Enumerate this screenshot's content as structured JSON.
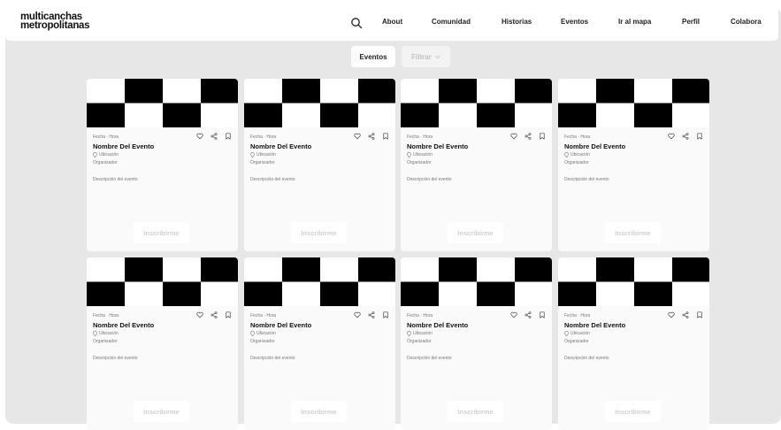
{
  "brand": {
    "line1": "multicanchas",
    "line2": "metropolitanas"
  },
  "nav": {
    "search_icon": "search-icon",
    "links": [
      "About",
      "Comunidad",
      "Historias",
      "Eventos",
      "Ir al mapa",
      "Perfil",
      "Colabora"
    ]
  },
  "toolbar": {
    "events_label": "Eventos",
    "filter_label": "Filtrar",
    "filter_icon": "chevron-down-icon"
  },
  "colors": {
    "background": "#e7e7e7",
    "card": "#fafafa",
    "placeholder_dark": "#000000",
    "muted_text": "#777777",
    "button_text": "#cfcfcf"
  },
  "cards": [
    {
      "meta": "Fecha · Hora",
      "title": "Nombre Del Evento",
      "location": "Ubicación",
      "organizer": "Organizador",
      "description": "Descripción del evento",
      "button": "Inscribirme"
    },
    {
      "meta": "Fecha · Hora",
      "title": "Nombre Del Evento",
      "location": "Ubicación",
      "organizer": "Organizador",
      "description": "Descripción del evento",
      "button": "Inscribirme"
    },
    {
      "meta": "Fecha · Hora",
      "title": "Nombre Del Evento",
      "location": "Ubicación",
      "organizer": "Organizador",
      "description": "Descripción del evento",
      "button": "Inscribirme"
    },
    {
      "meta": "Fecha · Hora",
      "title": "Nombre Del Evento",
      "location": "Ubicación",
      "organizer": "Organizador",
      "description": "Descripción del evento",
      "button": "Inscribirme"
    },
    {
      "meta": "Fecha · Hora",
      "title": "Nombre Del Evento",
      "location": "Ubicación",
      "organizer": "Organizador",
      "description": "Descripción del evento",
      "button": "Inscribirme"
    },
    {
      "meta": "Fecha · Hora",
      "title": "Nombre Del Evento",
      "location": "Ubicación",
      "organizer": "Organizador",
      "description": "Descripción del evento",
      "button": "Inscribirme"
    },
    {
      "meta": "Fecha · Hora",
      "title": "Nombre Del Evento",
      "location": "Ubicación",
      "organizer": "Organizador",
      "description": "Descripción del evento",
      "button": "Inscribirme"
    },
    {
      "meta": "Fecha · Hora",
      "title": "Nombre Del Evento",
      "location": "Ubicación",
      "organizer": "Organizador",
      "description": "Descripción del evento",
      "button": "Inscribirme"
    }
  ]
}
